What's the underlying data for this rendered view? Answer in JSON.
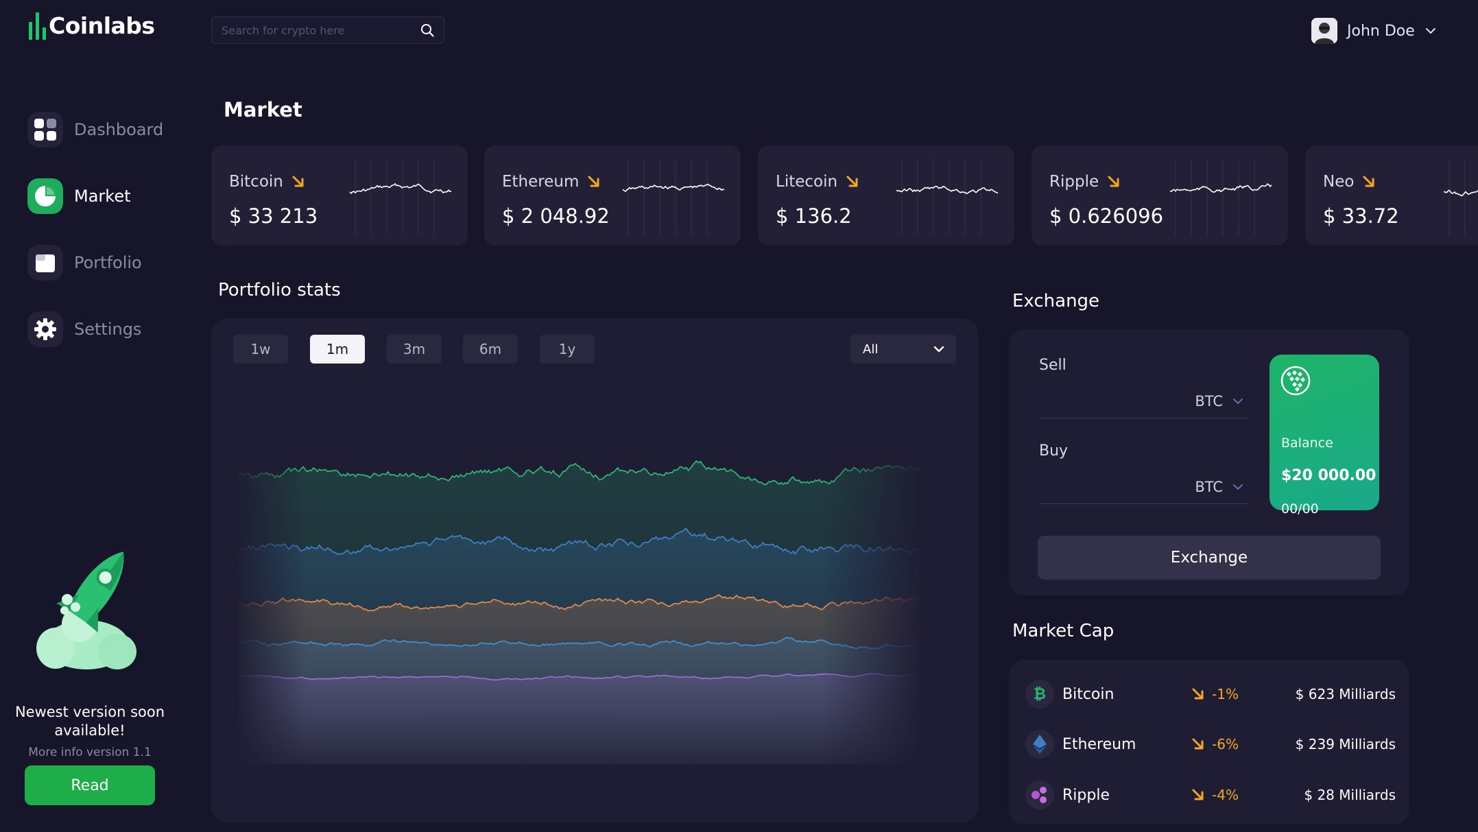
{
  "app": {
    "name": "Coinlabs",
    "brand_color": "#23c56b"
  },
  "search": {
    "placeholder": "Search for crypto here",
    "icon": "search-icon"
  },
  "user": {
    "name": "John Doe"
  },
  "nav": {
    "items": [
      {
        "label": "Dashboard",
        "icon": "dashboard-grid-icon",
        "active": false
      },
      {
        "label": "Market",
        "icon": "pie-chart-icon",
        "active": true
      },
      {
        "label": "Portfolio",
        "icon": "portfolio-icon",
        "active": false
      },
      {
        "label": "Settings",
        "icon": "gear-icon",
        "active": false
      }
    ]
  },
  "promo": {
    "title": "Newest version soon available!",
    "subtitle": "More info version 1.1",
    "button": "Read"
  },
  "market": {
    "title": "Market",
    "tickers": [
      {
        "name": "Bitcoin",
        "price": "$ 33 213",
        "trend": "down"
      },
      {
        "name": "Ethereum",
        "price": "$ 2 048.92",
        "trend": "down"
      },
      {
        "name": "Litecoin",
        "price": "$ 136.2",
        "trend": "down"
      },
      {
        "name": "Ripple",
        "price": "$ 0.626096",
        "trend": "down"
      },
      {
        "name": "Neo",
        "price": "$ 33.72",
        "trend": "down"
      }
    ]
  },
  "portfolio_stats": {
    "title": "Portfolio stats",
    "periods": [
      "1w",
      "1m",
      "3m",
      "6m",
      "1y"
    ],
    "active_period": "1m",
    "filter": "All",
    "series_colors": [
      "#2bb673",
      "#3d7fc4",
      "#e0894a",
      "#3d8fd0",
      "#9a6cd0"
    ]
  },
  "exchange": {
    "title": "Exchange",
    "sell_label": "Sell",
    "sell_currency": "BTC",
    "buy_label": "Buy",
    "buy_currency": "BTC",
    "balance_label": "Balance",
    "balance_amount": "$20 000.00",
    "card_number": "00/00",
    "button": "Exchange"
  },
  "market_cap": {
    "title": "Market Cap",
    "rows": [
      {
        "name": "Bitcoin",
        "change": "-1%",
        "cap": "$ 623 Milliards",
        "icon": "bitcoin-icon",
        "color": "#2bb673"
      },
      {
        "name": "Ethereum",
        "change": "-6%",
        "cap": "$ 239 Milliards",
        "icon": "ethereum-icon",
        "color": "#3d7fc4"
      },
      {
        "name": "Ripple",
        "change": "-4%",
        "cap": "$ 28 Milliards",
        "icon": "ripple-icon",
        "color": "#b455d6"
      }
    ]
  },
  "colors": {
    "background": "#16152a",
    "panel": "#1f1d33",
    "down": "#f5a623",
    "accent": "#1fad5d"
  }
}
